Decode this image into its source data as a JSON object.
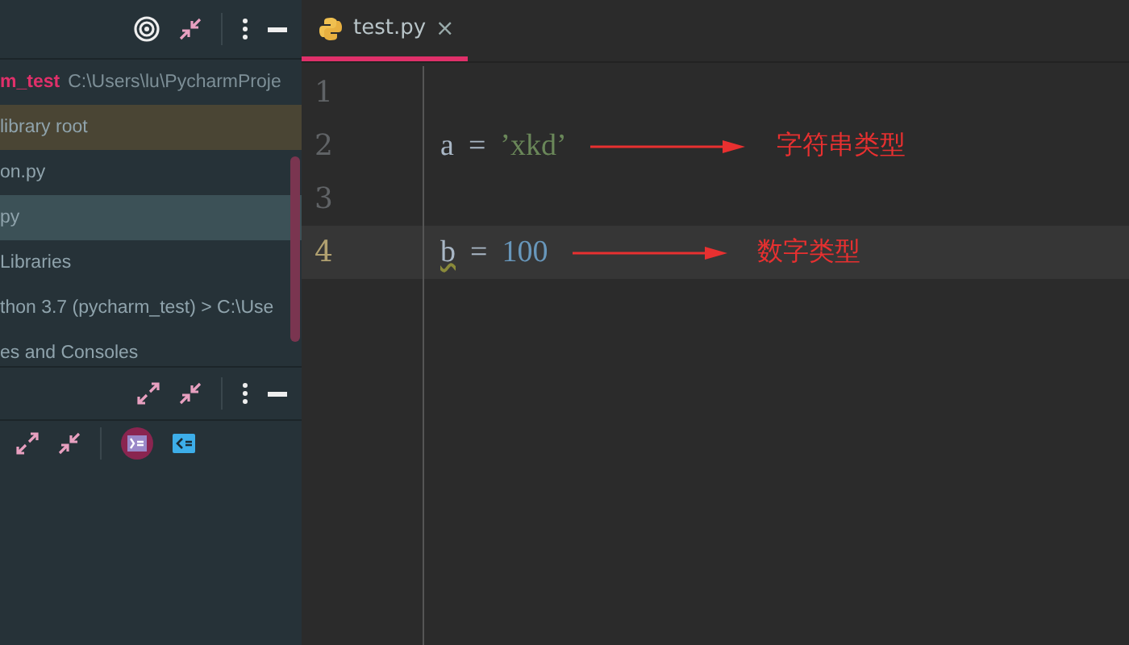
{
  "project_panel": {
    "tree": [
      {
        "kind": "root",
        "label": "m_test",
        "path": "C:\\Users\\lu\\PycharmProje",
        "selected": false,
        "highlighted": false
      },
      {
        "kind": "item",
        "label": "library root",
        "selected": false,
        "highlighted": true
      },
      {
        "kind": "item",
        "label": "on.py",
        "selected": false,
        "highlighted": false
      },
      {
        "kind": "item",
        "label": "py",
        "selected": true,
        "highlighted": false
      },
      {
        "kind": "item",
        "label": "Libraries",
        "selected": false,
        "highlighted": false
      },
      {
        "kind": "item",
        "label": "thon 3.7 (pycharm_test)  >  C:\\Use",
        "selected": false,
        "highlighted": false
      },
      {
        "kind": "item",
        "label": "es and Consoles",
        "selected": false,
        "highlighted": false
      }
    ]
  },
  "editor": {
    "tabs": [
      {
        "label": "test.py",
        "close": "×",
        "selected": true
      }
    ],
    "lines": [
      {
        "number": "1",
        "current": false
      },
      {
        "number": "2",
        "current": false,
        "tokens": [
          {
            "kind": "ident",
            "text": "a",
            "warning": false
          },
          {
            "kind": "op",
            "text": "=",
            "warning": false
          },
          {
            "kind": "string",
            "text": "’xkd’",
            "warning": false
          }
        ],
        "annotation": "字符串类型"
      },
      {
        "number": "3",
        "current": false
      },
      {
        "number": "4",
        "current": true,
        "tokens": [
          {
            "kind": "ident",
            "text": "b",
            "warning": true
          },
          {
            "kind": "op",
            "text": "=",
            "warning": false
          },
          {
            "kind": "number",
            "text": "100",
            "warning": false
          }
        ],
        "annotation": "数字类型"
      }
    ]
  }
}
